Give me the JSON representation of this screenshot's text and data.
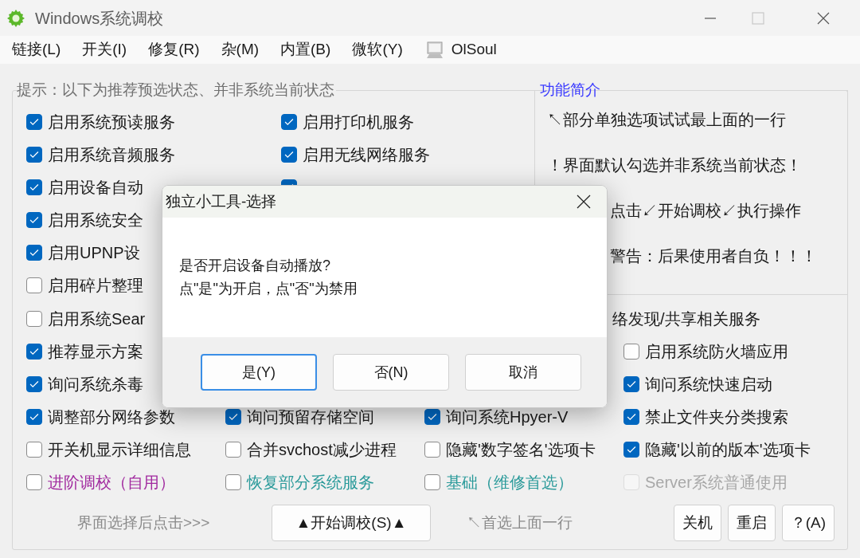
{
  "window": {
    "title": "Windows系统调校"
  },
  "menu": [
    {
      "label": "链接(L)",
      "kind": "text"
    },
    {
      "label": "开关(I)",
      "kind": "text"
    },
    {
      "label": "修复(R)",
      "kind": "text"
    },
    {
      "label": "杂(M)",
      "kind": "text"
    },
    {
      "label": "内置(B)",
      "kind": "text"
    },
    {
      "label": "微软(Y)",
      "kind": "text"
    },
    {
      "label": "OlSoul",
      "kind": "icon"
    }
  ],
  "options_group": {
    "legend": "提示：以下为推荐预选状态、并非系统当前状态",
    "upper_rows": [
      {
        "items": [
          {
            "label": "启用系统预读服务",
            "checked": true,
            "disabled": false
          },
          {
            "label": "启用打印机服务",
            "checked": true,
            "disabled": false
          }
        ]
      },
      {
        "items": [
          {
            "label": "启用系统音频服务",
            "checked": true,
            "disabled": false
          },
          {
            "label": "启用无线网络服务",
            "checked": true,
            "disabled": false
          }
        ]
      },
      {
        "items": [
          {
            "label": "启用设备自动",
            "checked": true,
            "disabled": false
          },
          {
            "checked": true
          }
        ]
      },
      {
        "items": [
          {
            "label": "启用系统安全",
            "checked": true,
            "disabled": false
          }
        ]
      },
      {
        "items": [
          {
            "label": "启用UPNP设",
            "checked": true,
            "disabled": false
          }
        ]
      },
      {
        "items": [
          {
            "label": "启用碎片整理",
            "checked": false,
            "disabled": false
          }
        ]
      }
    ],
    "lower_rows": [
      {
        "items": [
          {
            "label": "启用系统Sear",
            "checked": false,
            "disabled": false
          }
        ],
        "trailing_text": "络发现/共享相关服务"
      },
      {
        "items": [
          {
            "label": "推荐显示方案",
            "checked": true,
            "disabled": false
          },
          {
            "label": "启用系统防火墙应用",
            "checked": false,
            "disabled": false
          }
        ]
      },
      {
        "items": [
          {
            "label": "询问系统杀毒",
            "checked": true,
            "disabled": false
          },
          {
            "label": "询问系统快速启动",
            "checked": true,
            "disabled": false
          }
        ]
      },
      {
        "items": [
          {
            "label": "调整部分网络参数",
            "checked": true,
            "disabled": false
          },
          {
            "label": "询问预留存储空间",
            "checked": true,
            "disabled": false
          },
          {
            "label": "询问系统Hpyer-V",
            "checked": true,
            "disabled": false
          },
          {
            "label": "禁止文件夹分类搜索",
            "checked": true,
            "disabled": false
          }
        ]
      },
      {
        "items": [
          {
            "label": "开关机显示详细信息",
            "checked": false,
            "disabled": false
          },
          {
            "label": "合并svchost减少进程",
            "checked": false,
            "disabled": false
          },
          {
            "label": "隐藏'数字签名'选项卡",
            "checked": false,
            "disabled": false
          },
          {
            "label": "隐藏'以前的版本'选项卡",
            "checked": true,
            "disabled": false
          }
        ]
      },
      {
        "items": [
          {
            "label": "进阶调校（自用）",
            "checked": false,
            "disabled": false,
            "color": "#a12a9f"
          },
          {
            "label": "恢复部分系统服务",
            "checked": false,
            "disabled": false,
            "color": "#2a9a9a"
          },
          {
            "label": "基础（维修首选）",
            "checked": false,
            "disabled": false,
            "color": "#2a9a9a"
          },
          {
            "label": "Server系统普通使用",
            "checked": false,
            "disabled": true
          }
        ]
      }
    ]
  },
  "info_box": {
    "legend": "功能简介",
    "lines": [
      {
        "text": "↖部分单独选项试试最上面的一行",
        "kind": "full"
      },
      {
        "text": "！界面默认勾选并非系统当前状态！",
        "kind": "full"
      },
      {
        "text": "点击↙开始调校↙执行操作",
        "kind": "cut"
      },
      {
        "text": "警告：后果使用者自负！！！",
        "kind": "cut"
      }
    ]
  },
  "footer": {
    "hint": "界面选择后点击>>>",
    "start_button": "▲开始调校(S)▲",
    "note": "↖首选上面一行",
    "buttons": [
      "关机",
      "重启",
      "？(A)"
    ]
  },
  "dialog": {
    "title": "独立小工具-选择",
    "message_lines": [
      "是否开启设备自动播放?",
      "点\"是\"为开启，点\"否\"为禁用"
    ],
    "buttons": [
      {
        "label": "是(Y)",
        "selected": true
      },
      {
        "label": "否(N)",
        "selected": false
      },
      {
        "label": "取消",
        "selected": false
      }
    ]
  }
}
